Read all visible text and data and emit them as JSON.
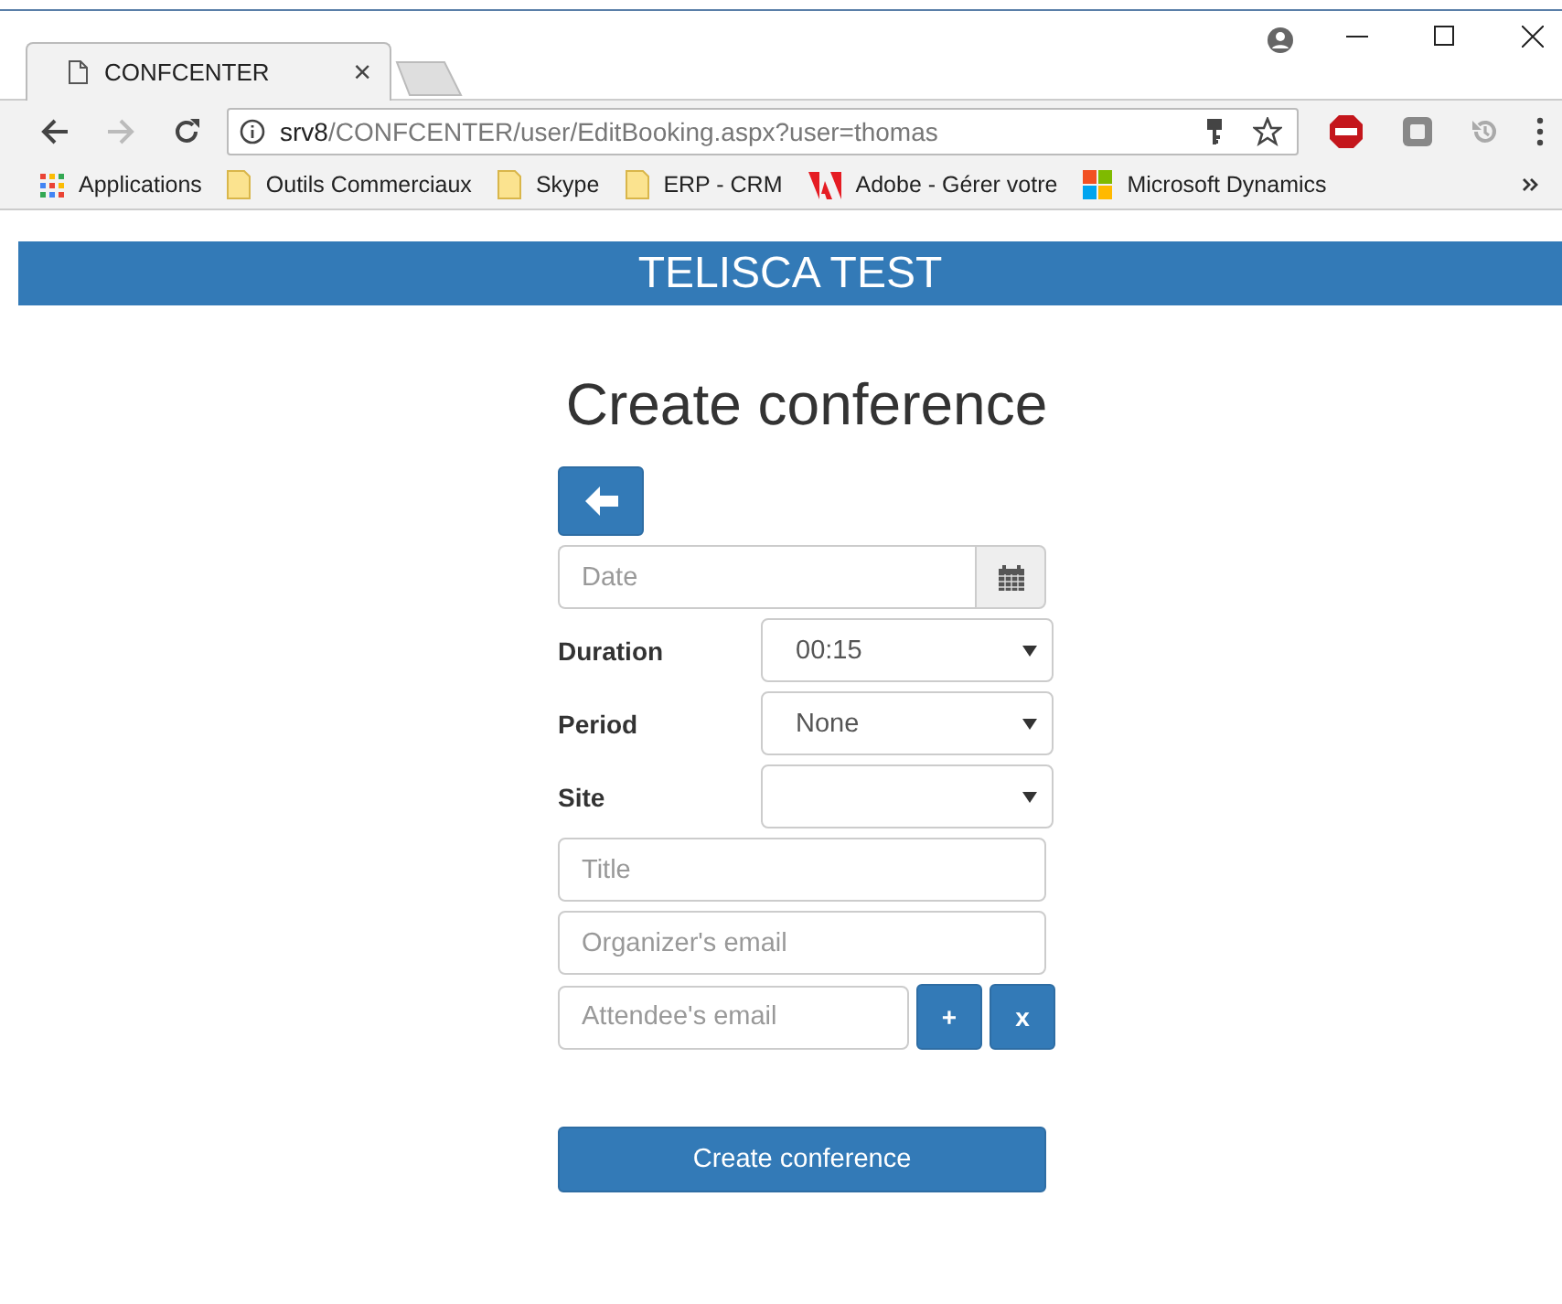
{
  "browser": {
    "tab": {
      "title": "CONFCENTER",
      "close": "×"
    },
    "address": {
      "host": "srv8",
      "path": "/CONFCENTER/user/EditBooking.aspx?user=thomas"
    },
    "bookmarks": [
      {
        "kind": "apps",
        "label": "Applications"
      },
      {
        "kind": "folder",
        "label": "Outils Commerciaux"
      },
      {
        "kind": "folder",
        "label": "Skype"
      },
      {
        "kind": "folder",
        "label": "ERP - CRM"
      },
      {
        "kind": "adobe",
        "label": "Adobe - Gérer votre"
      },
      {
        "kind": "windows",
        "label": "Microsoft Dynamics"
      }
    ]
  },
  "header": {
    "title": "TELISCA TEST"
  },
  "form": {
    "title": "Create conference",
    "date": {
      "placeholder": "Date"
    },
    "selects": [
      {
        "label": "Duration",
        "value": "00:15"
      },
      {
        "label": "Period",
        "value": "None"
      },
      {
        "label": "Site"
      }
    ],
    "fields": [
      {
        "placeholder": "Title"
      },
      {
        "placeholder": "Organizer's email"
      }
    ],
    "attendee": {
      "placeholder": "Attendee's email",
      "add": "+",
      "remove": "x"
    },
    "submit": "Create conference"
  }
}
